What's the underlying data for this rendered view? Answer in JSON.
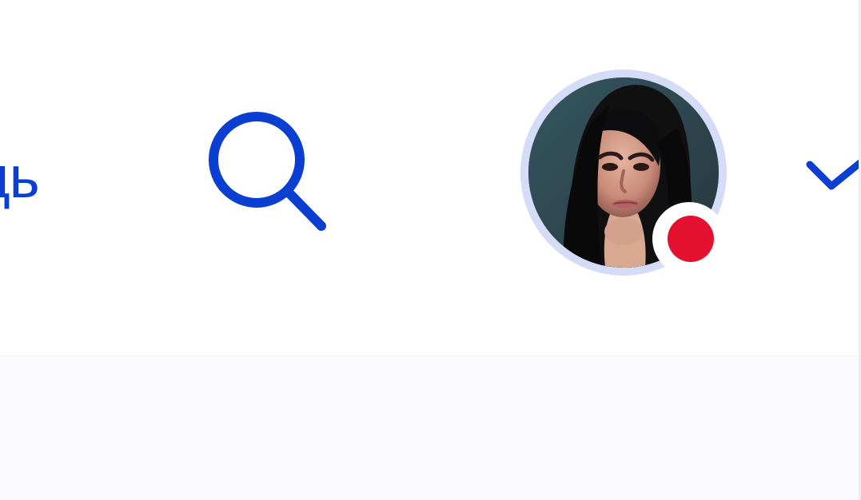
{
  "header": {
    "partial_nav_label": "дь",
    "search_icon": "search-icon",
    "avatar": {
      "icon": "user-avatar",
      "status_color": "#e3112f"
    },
    "dropdown_icon": "chevron-down-icon"
  },
  "colors": {
    "accent": "#0b3fd1",
    "avatar_ring": "#d5dcf8",
    "status_dot": "#e3112f",
    "content_background": "#fafaff",
    "header_background": "#ffffff"
  }
}
